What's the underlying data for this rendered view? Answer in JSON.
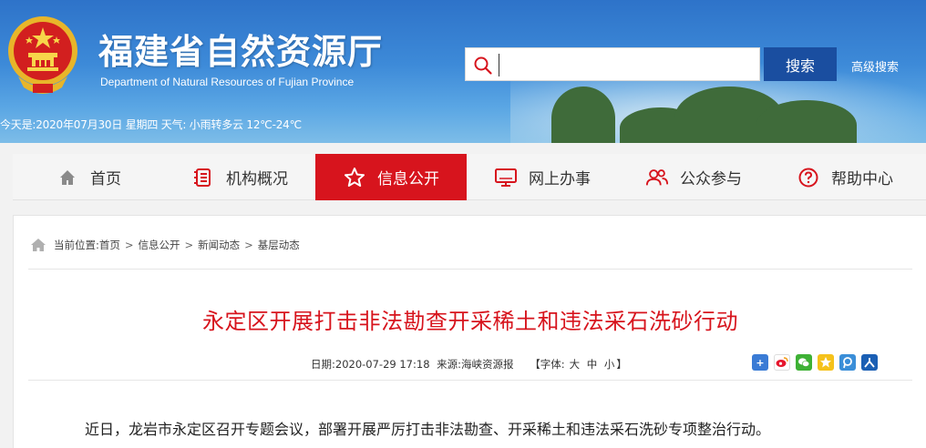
{
  "header": {
    "site_title": "福建省自然资源厅",
    "site_subtitle": "Department of Natural Resources of Fujian Province",
    "search_placeholder": "",
    "search_button": "搜索",
    "advanced_search": "高级搜索",
    "weather_line": "今天是:2020年07月30日  星期四 天气: 小雨转多云 12℃-24℃"
  },
  "nav": {
    "items": [
      {
        "label": "首页",
        "icon": "home-icon"
      },
      {
        "label": "机构概况",
        "icon": "document-list-icon"
      },
      {
        "label": "信息公开",
        "icon": "star-icon"
      },
      {
        "label": "网上办事",
        "icon": "monitor-icon"
      },
      {
        "label": "公众参与",
        "icon": "users-icon"
      },
      {
        "label": "帮助中心",
        "icon": "help-icon"
      }
    ],
    "active_index": 2
  },
  "breadcrumb": {
    "prefix": "当前位置:",
    "items": [
      "首页",
      "信息公开",
      "新闻动态",
      "基层动态"
    ]
  },
  "article": {
    "title": "永定区开展打击非法勘查开采稀土和违法采石洗砂行动",
    "date_label": "日期:",
    "date": "2020-07-29 17:18",
    "source_label": "来源:",
    "source": "海峡资源报",
    "font_label": "【字体:",
    "font_sizes": [
      "大",
      "中",
      "小"
    ],
    "font_close": "】",
    "first_paragraph": "近日，龙岩市永定区召开专题会议，部署开展严厉打击非法勘查、开采稀土和违法采石洗砂专项整治行动。"
  },
  "share_icons": [
    "plus-share-icon",
    "weibo-icon",
    "wechat-icon",
    "qzone-icon",
    "tencent-icon",
    "renren-icon"
  ],
  "colors": {
    "accent_red": "#d7141d",
    "nav_bg": "#f5f5f5",
    "search_button": "#1a4ea0",
    "header_blue": "#2e73c9"
  }
}
